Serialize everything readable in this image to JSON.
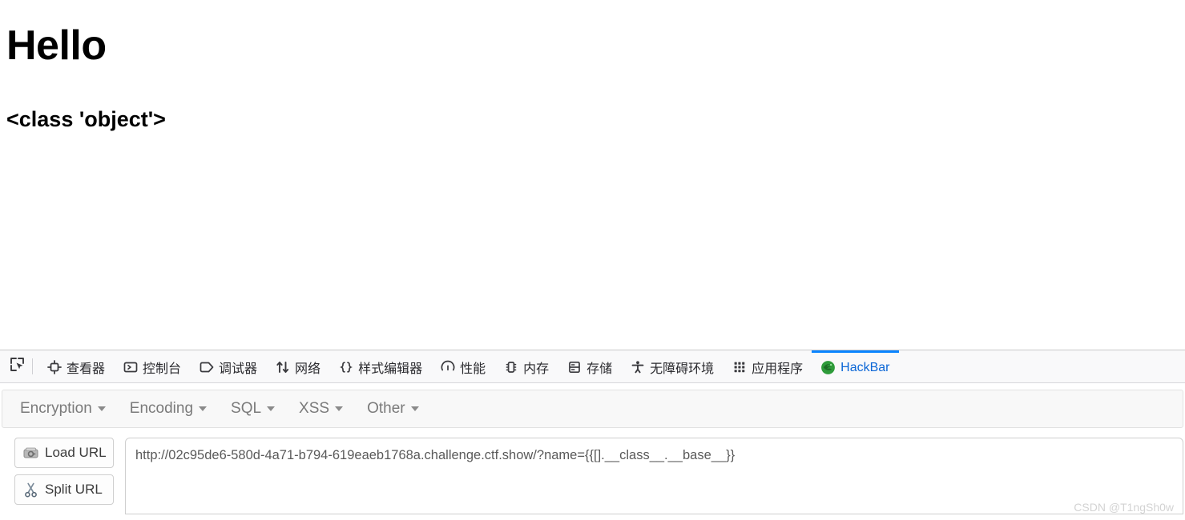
{
  "page": {
    "heading": "Hello",
    "result": "<class 'object'>"
  },
  "devtools": {
    "picker_icon": "element-picker-icon",
    "tabs": [
      {
        "label": "查看器",
        "icon": "inspector-icon",
        "selected": false
      },
      {
        "label": "控制台",
        "icon": "console-icon",
        "selected": false
      },
      {
        "label": "调试器",
        "icon": "debugger-icon",
        "selected": false
      },
      {
        "label": "网络",
        "icon": "network-icon",
        "selected": false
      },
      {
        "label": "样式编辑器",
        "icon": "style-editor-icon",
        "selected": false
      },
      {
        "label": "性能",
        "icon": "performance-icon",
        "selected": false
      },
      {
        "label": "内存",
        "icon": "memory-icon",
        "selected": false
      },
      {
        "label": "存储",
        "icon": "storage-icon",
        "selected": false
      },
      {
        "label": "无障碍环境",
        "icon": "accessibility-icon",
        "selected": false
      },
      {
        "label": "应用程序",
        "icon": "application-icon",
        "selected": false
      },
      {
        "label": "HackBar",
        "icon": "hackbar-icon",
        "selected": true
      }
    ],
    "selected_tab_color": "#0a84ff"
  },
  "hackbar": {
    "menus": [
      {
        "label": "Encryption"
      },
      {
        "label": "Encoding"
      },
      {
        "label": "SQL"
      },
      {
        "label": "XSS"
      },
      {
        "label": "Other"
      }
    ],
    "buttons": [
      {
        "label": "Load URL",
        "icon": "load-url-icon"
      },
      {
        "label": "Split URL",
        "icon": "split-url-scissors-icon"
      }
    ],
    "url_field": {
      "value": "http://02c95de6-580d-4a71-b794-619eaeb1768a.challenge.ctf.show/?name={{[].__class__.__base__}}",
      "placeholder": "URL"
    }
  },
  "watermark": "CSDN @T1ngSh0w"
}
